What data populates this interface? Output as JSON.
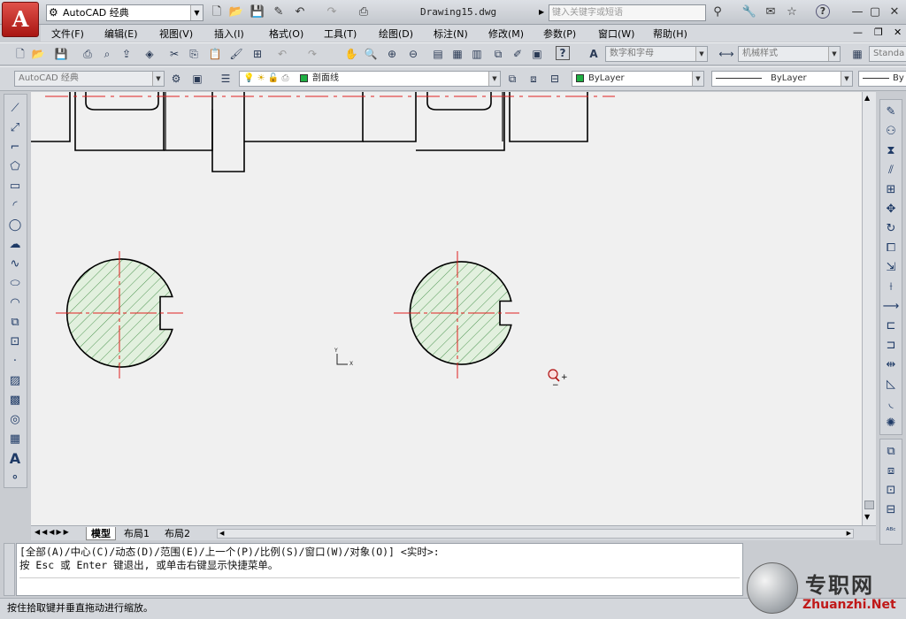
{
  "title_bar": {
    "workspace": "AutoCAD 经典",
    "document_title": "Drawing15.dwg",
    "search_placeholder": "键入关键字或短语",
    "help_label": "?"
  },
  "menu": {
    "items": [
      "文件(F)",
      "编辑(E)",
      "视图(V)",
      "插入(I)",
      "格式(O)",
      "工具(T)",
      "绘图(D)",
      "标注(N)",
      "修改(M)",
      "参数(P)",
      "窗口(W)",
      "帮助(H)"
    ]
  },
  "toolbar_styles": {
    "text_style": "数字和字母",
    "dim_style": "机械样式",
    "table_style": "Standa"
  },
  "layers_toolbar": {
    "workspace": "AutoCAD 经典",
    "current_layer": "剖面线",
    "color": "ByLayer",
    "linetype": "ByLayer",
    "lineweight": "By"
  },
  "layout_tabs": {
    "items": [
      "模型",
      "布局1",
      "布局2"
    ],
    "active_index": 0
  },
  "command_line": {
    "line1": "[全部(A)/中心(C)/动态(D)/范围(E)/上一个(P)/比例(S)/窗口(W)/对象(O)] <实时>:",
    "line2": "按 Esc 或 Enter 键退出, 或单击右键显示快捷菜单。"
  },
  "status_bar": {
    "text": "按住拾取键并垂直拖动进行缩放。"
  },
  "watermark": {
    "name": "专职网",
    "url": "Zhuanzhi.Net"
  },
  "ucs": {
    "x_label": "X",
    "y_label": "Y"
  },
  "colors": {
    "centerline": "#e02020",
    "hatch_fill": "#e2f0de",
    "hatch_line": "#3f8d44",
    "layer_swatch": "#1fb043"
  }
}
